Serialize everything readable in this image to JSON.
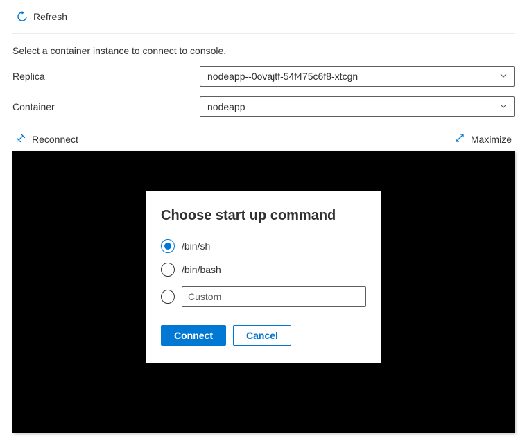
{
  "toolbar": {
    "refresh_label": "Refresh"
  },
  "subtitle": "Select a container instance to connect to console.",
  "form": {
    "replica_label": "Replica",
    "replica_value": "nodeapp--0ovajtf-54f475c6f8-xtcgn",
    "container_label": "Container",
    "container_value": "nodeapp"
  },
  "actions": {
    "reconnect_label": "Reconnect",
    "maximize_label": "Maximize"
  },
  "dialog": {
    "title": "Choose start up command",
    "options": {
      "sh": "/bin/sh",
      "bash": "/bin/bash",
      "custom_placeholder": "Custom"
    },
    "selected": "sh",
    "connect_label": "Connect",
    "cancel_label": "Cancel"
  },
  "colors": {
    "accent": "#0078d4",
    "terminal_bg": "#000000"
  }
}
